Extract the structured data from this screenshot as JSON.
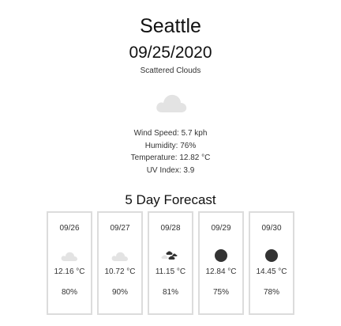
{
  "current": {
    "city": "Seattle",
    "date": "09/25/2020",
    "description": "Scattered Clouds",
    "icon": "cloud-icon",
    "stats": {
      "wind_speed": "Wind Speed: 5.7 kph",
      "humidity": "Humidity: 76%",
      "temperature": "Temperature: 12.82 °C",
      "uv_index": "UV Index: 3.9"
    }
  },
  "forecast": {
    "title": "5 Day Forecast",
    "days": [
      {
        "date": "09/26",
        "icon": "cloud-icon",
        "temp": "12.16 °C",
        "humidity": "80%"
      },
      {
        "date": "09/27",
        "icon": "cloud-icon",
        "temp": "10.72 °C",
        "humidity": "90%"
      },
      {
        "date": "09/28",
        "icon": "broken-clouds-icon",
        "temp": "11.15 °C",
        "humidity": "81%"
      },
      {
        "date": "09/29",
        "icon": "overcast-icon",
        "temp": "12.84 °C",
        "humidity": "75%"
      },
      {
        "date": "09/30",
        "icon": "overcast-icon",
        "temp": "14.45 °C",
        "humidity": "78%"
      }
    ]
  },
  "colors": {
    "cloud_light": "#e3e3e3",
    "cloud_dark": "#333333",
    "card_border": "#dcdcdc"
  }
}
